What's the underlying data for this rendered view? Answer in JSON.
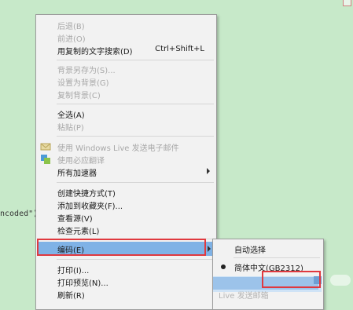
{
  "background_color": "#c7e9c9",
  "left_fragment": "ncoded\"):",
  "menu": {
    "items": [
      {
        "label": "后退(B)",
        "disabled": true
      },
      {
        "label": "前进(O)",
        "disabled": true
      },
      {
        "label": "用复制的文字搜索(D)",
        "shortcut": "Ctrl+Shift+L"
      },
      {
        "label": "背景另存为(S)...",
        "disabled": true
      },
      {
        "label": "设置为背景(G)",
        "disabled": true
      },
      {
        "label": "复制背景(C)",
        "disabled": true
      },
      {
        "label": "全选(A)"
      },
      {
        "label": "粘贴(P)",
        "disabled": true
      },
      {
        "label": "使用 Windows Live 发送电子邮件",
        "disabled": true
      },
      {
        "label": "使用必应翻译",
        "disabled": true
      },
      {
        "label": "所有加速器"
      },
      {
        "label": "创建快捷方式(T)"
      },
      {
        "label": "添加到收藏夹(F)..."
      },
      {
        "label": "查看源(V)"
      },
      {
        "label": "检查元素(L)"
      },
      {
        "label": "编码(E)"
      },
      {
        "label": "打印(I)..."
      },
      {
        "label": "打印预览(N)..."
      },
      {
        "label": "刷新(R)"
      }
    ]
  },
  "submenu": {
    "items": [
      {
        "label": "自动选择"
      },
      {
        "label": "简体中文(GB2312)"
      },
      {
        "label": "Live 发送邮箱"
      }
    ]
  }
}
